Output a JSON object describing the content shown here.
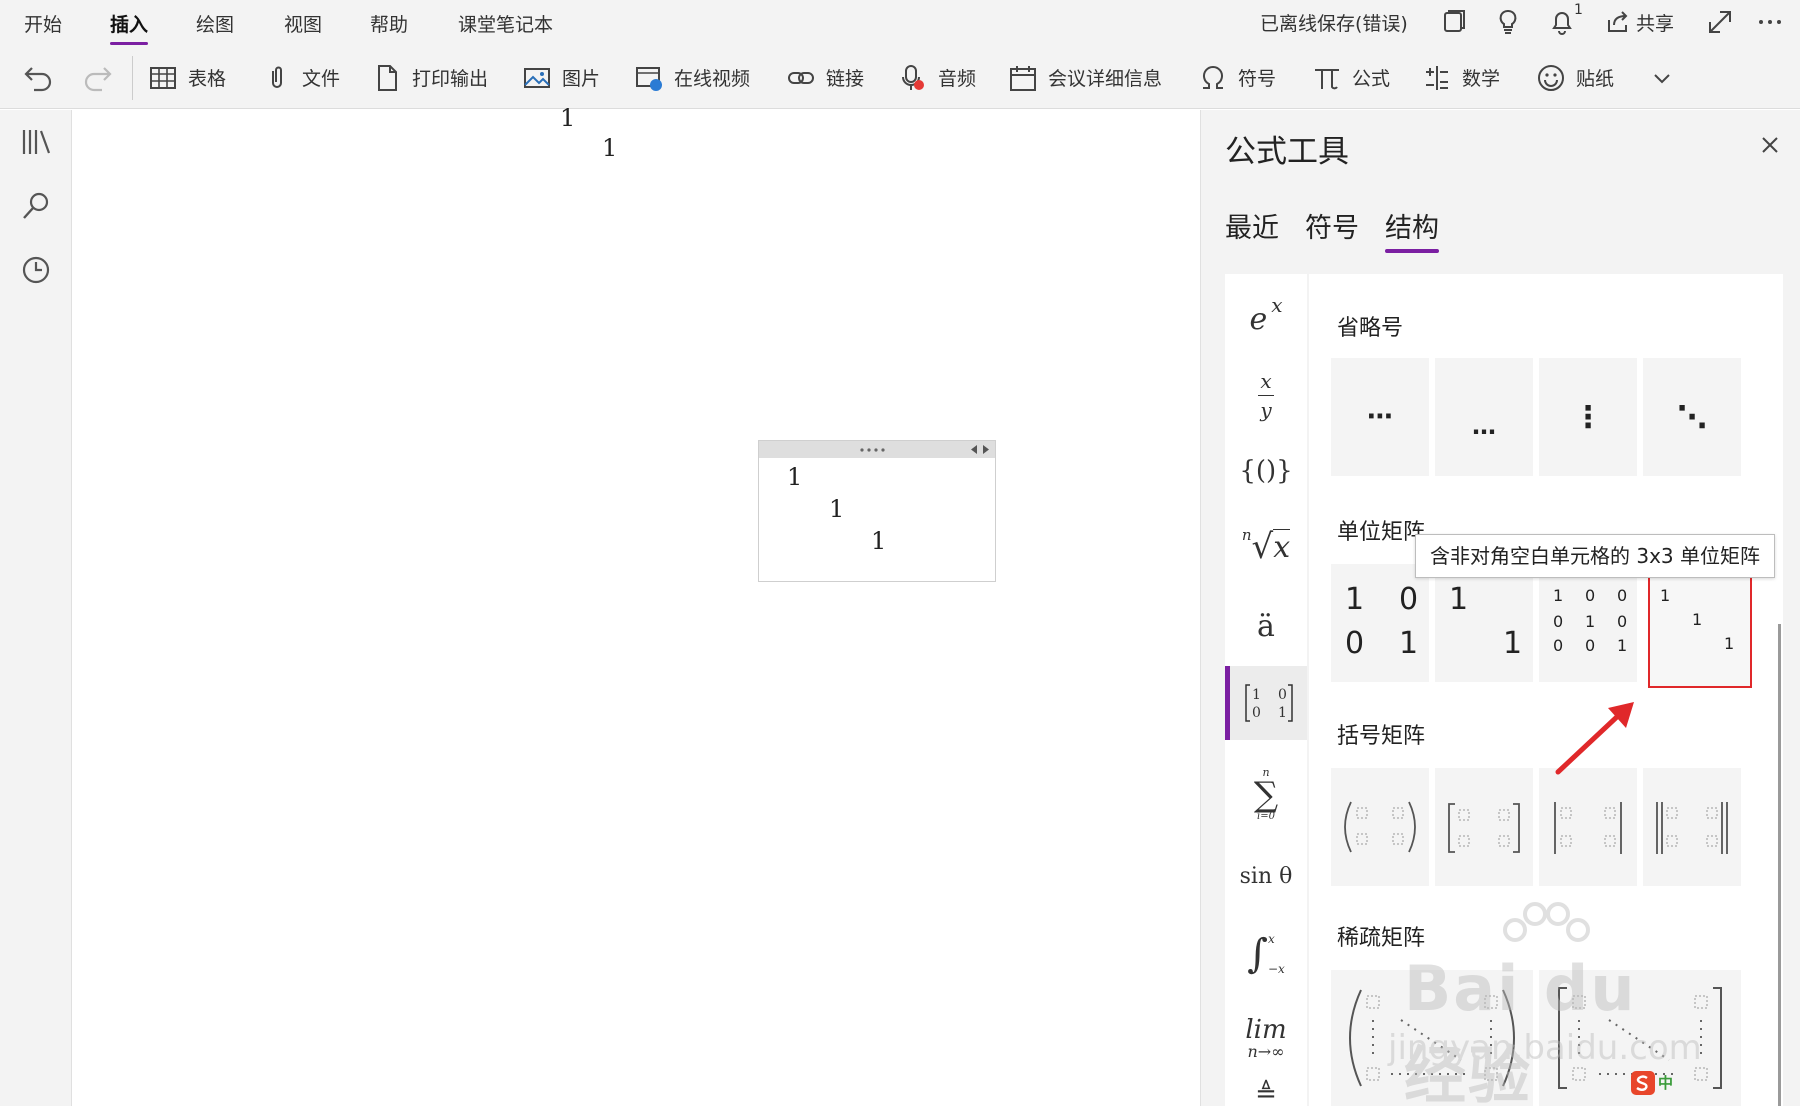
{
  "menu": {
    "tabs": [
      "开始",
      "插入",
      "绘图",
      "视图",
      "帮助",
      "课堂笔记本"
    ],
    "active_tab": "插入",
    "status": "已离线保存(错误)",
    "notification_count": "1",
    "share_label": "共享"
  },
  "ribbon": {
    "items": [
      "表格",
      "文件",
      "打印输出",
      "图片",
      "在线视频",
      "链接",
      "音频",
      "会议详细信息",
      "符号",
      "公式",
      "数学",
      "贴纸"
    ]
  },
  "canvas": {
    "page_numbers": [
      "1",
      "1"
    ],
    "equation_values": [
      "1",
      "1",
      "1"
    ]
  },
  "panel": {
    "title": "公式工具",
    "tabs": [
      "最近",
      "符号",
      "结构"
    ],
    "active_tab": "结构",
    "categories": {
      "exp_base": "e",
      "exp_sup": "x",
      "frac_num": "x",
      "frac_den": "y",
      "bracket": "{()}",
      "root_index": "n",
      "root_arg": "x",
      "accent": "ä",
      "sum_top": "n",
      "sum_sym": "∑",
      "sum_bottom": "i=0",
      "func": "sin θ",
      "int_top": "x",
      "int_bottom": "−x",
      "lim_top": "lim",
      "lim_bottom": "n→∞",
      "op": "≜"
    },
    "sections": {
      "ellipsis": "省略号",
      "identity": "单位矩阵",
      "bracket_matrix": "括号矩阵",
      "sparse": "稀疏矩阵"
    },
    "ellipsis_tiles": [
      "⋯",
      "…",
      "⋮",
      "⋱"
    ],
    "identity_2x2": [
      "1",
      "0",
      "0",
      "1"
    ],
    "identity_2x2_blank": [
      "1",
      "1"
    ],
    "identity_3x3": [
      "1",
      "0",
      "0",
      "0",
      "1",
      "0",
      "0",
      "0",
      "1"
    ],
    "identity_3x3_blank": [
      "1",
      "1",
      "1"
    ],
    "tooltip": "含非对角空白单元格的 3x3 单位矩阵"
  },
  "watermark": {
    "text": "Bai du 经验",
    "url": "jingyan.baidu.com"
  },
  "ime": {
    "label": "中"
  }
}
